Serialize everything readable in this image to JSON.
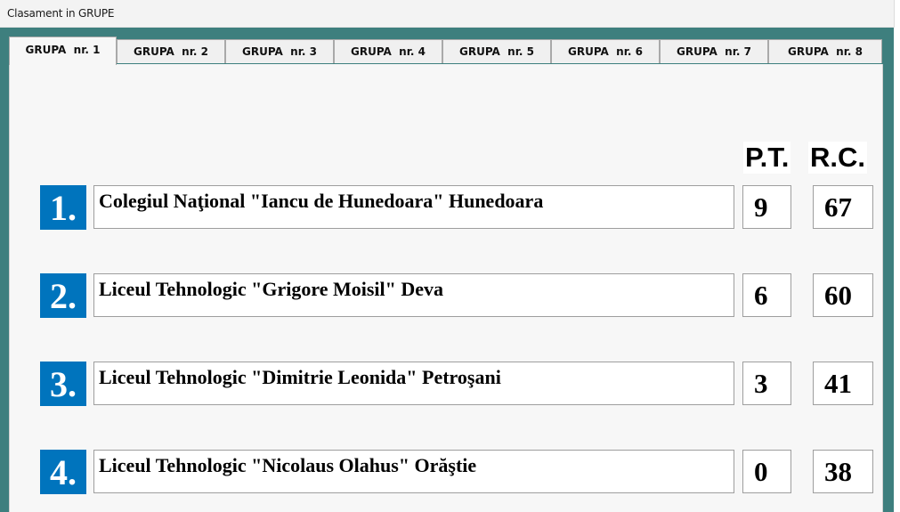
{
  "window": {
    "title": "Clasament in GRUPE"
  },
  "tabs": [
    {
      "label": "GRUPA  nr. 1",
      "active": true
    },
    {
      "label": "GRUPA  nr. 2",
      "active": false
    },
    {
      "label": "GRUPA  nr. 3",
      "active": false
    },
    {
      "label": "GRUPA  nr. 4",
      "active": false
    },
    {
      "label": "GRUPA  nr. 5",
      "active": false
    },
    {
      "label": "GRUPA  nr. 6",
      "active": false
    },
    {
      "label": "GRUPA  nr. 7",
      "active": false
    },
    {
      "label": "GRUPA  nr. 8",
      "active": false
    }
  ],
  "columns": {
    "pt": "P.T.",
    "rc": "R.C."
  },
  "rows": [
    {
      "rank": "1.",
      "name": "Colegiul Naţional \"Iancu de Hunedoara\" Hunedoara",
      "pt": "9",
      "rc": "67"
    },
    {
      "rank": "2.",
      "name": "Liceul Tehnologic \"Grigore Moisil\" Deva",
      "pt": "6",
      "rc": "60"
    },
    {
      "rank": "3.",
      "name": "Liceul Tehnologic \"Dimitrie Leonida\" Petroşani",
      "pt": "3",
      "rc": "41"
    },
    {
      "rank": "4.",
      "name": "Liceul Tehnologic \"Nicolaus Olahus\" Orăştie",
      "pt": "0",
      "rc": "38"
    }
  ],
  "colors": {
    "background": "#3e7f7e",
    "rank_badge": "#0074bd",
    "panel": "#f7f7f7"
  }
}
